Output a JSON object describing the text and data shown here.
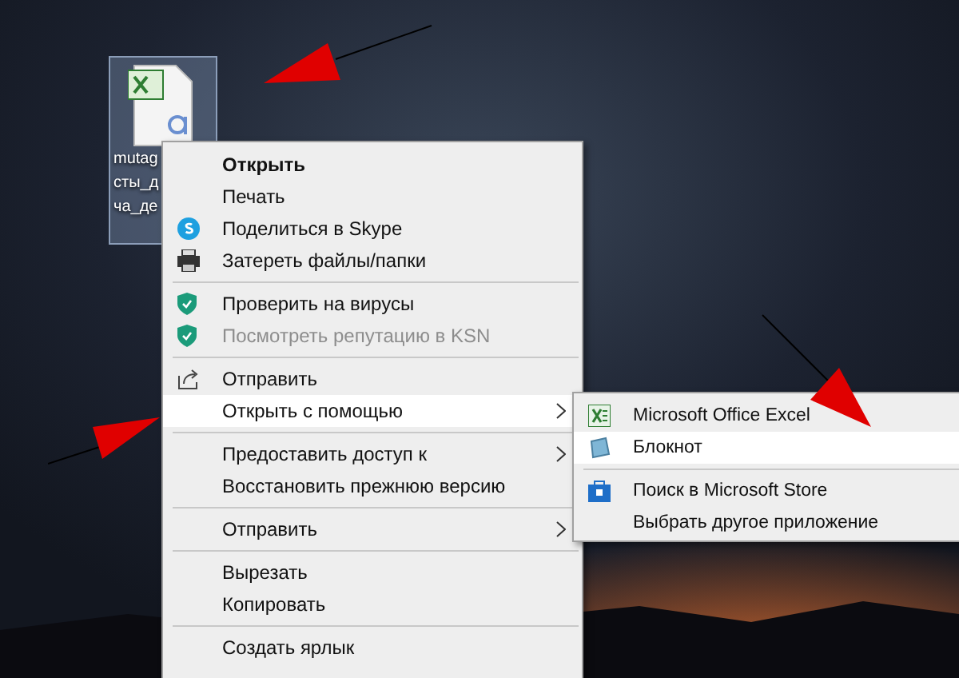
{
  "desktop_icon": {
    "label_lines": [
      "mutag",
      "сты_д",
      "ча_де"
    ],
    "selected": true
  },
  "context_menu": {
    "items": [
      {
        "kind": "item",
        "label": "Открыть",
        "default": true,
        "disabled": false,
        "selected": false,
        "submenu": false
      },
      {
        "kind": "item",
        "label": "Печать",
        "default": false,
        "disabled": false,
        "selected": false,
        "submenu": false
      },
      {
        "kind": "item",
        "label": "Поделиться в Skype",
        "default": false,
        "disabled": false,
        "selected": false,
        "submenu": false
      },
      {
        "kind": "item",
        "label": "Затереть файлы/папки",
        "default": false,
        "disabled": false,
        "selected": false,
        "submenu": false
      },
      {
        "kind": "separator"
      },
      {
        "kind": "item",
        "label": "Проверить на вирусы",
        "default": false,
        "disabled": false,
        "selected": false,
        "submenu": false
      },
      {
        "kind": "item",
        "label": "Посмотреть репутацию в KSN",
        "default": false,
        "disabled": true,
        "selected": false,
        "submenu": false
      },
      {
        "kind": "separator"
      },
      {
        "kind": "item",
        "label": "Отправить",
        "default": false,
        "disabled": false,
        "selected": false,
        "submenu": false
      },
      {
        "kind": "item",
        "label": "Открыть с помощью",
        "default": false,
        "disabled": false,
        "selected": true,
        "submenu": true
      },
      {
        "kind": "separator"
      },
      {
        "kind": "item",
        "label": "Предоставить доступ к",
        "default": false,
        "disabled": false,
        "selected": false,
        "submenu": true
      },
      {
        "kind": "item",
        "label": "Восстановить прежнюю версию",
        "default": false,
        "disabled": false,
        "selected": false,
        "submenu": false
      },
      {
        "kind": "separator"
      },
      {
        "kind": "item",
        "label": "Отправить",
        "default": false,
        "disabled": false,
        "selected": false,
        "submenu": true
      },
      {
        "kind": "separator"
      },
      {
        "kind": "item",
        "label": "Вырезать",
        "default": false,
        "disabled": false,
        "selected": false,
        "submenu": false
      },
      {
        "kind": "item",
        "label": "Копировать",
        "default": false,
        "disabled": false,
        "selected": false,
        "submenu": false
      },
      {
        "kind": "separator"
      },
      {
        "kind": "item",
        "label": "Создать ярлык",
        "default": false,
        "disabled": false,
        "selected": false,
        "submenu": false
      }
    ]
  },
  "submenu": {
    "items": [
      {
        "kind": "item",
        "label": "Microsoft Office Excel",
        "selected": false
      },
      {
        "kind": "item",
        "label": "Блокнот",
        "selected": true
      },
      {
        "kind": "separator"
      },
      {
        "kind": "item",
        "label": "Поиск в Microsoft Store",
        "selected": false
      },
      {
        "kind": "item",
        "label": "Выбрать другое приложение",
        "selected": false
      }
    ]
  }
}
